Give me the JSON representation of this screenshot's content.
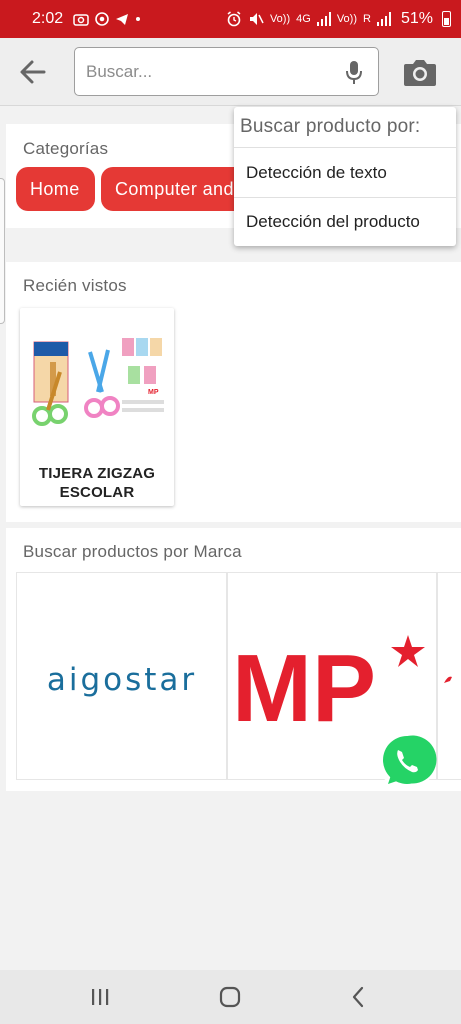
{
  "status_bar": {
    "time": "2:02",
    "net_labels": [
      "Vo))",
      "4G",
      "Vo))",
      "R"
    ],
    "battery": "51%"
  },
  "search": {
    "placeholder": "Buscar..."
  },
  "dropdown": {
    "header": "Buscar producto por:",
    "items": [
      {
        "label": "Detección de texto"
      },
      {
        "label": "Detección del producto"
      }
    ]
  },
  "categories": {
    "title": "Categorías",
    "chips": [
      {
        "label": "Home"
      },
      {
        "label": "Computer and"
      }
    ]
  },
  "recent": {
    "title": "Recién vistos",
    "products": [
      {
        "name": "TIJERA ZIGZAG ESCOLAR"
      }
    ]
  },
  "brands": {
    "title": "Buscar productos por Marca",
    "items": [
      {
        "name": "aigostar",
        "color": "#1a6e9c"
      },
      {
        "name": "MP",
        "color": "#e4202e"
      }
    ]
  },
  "colors": {
    "status_bar": "#c9191e",
    "chip": "#e53935",
    "whatsapp": "#25d366"
  },
  "icons": {
    "back": "arrow-left-icon",
    "mic": "microphone-icon",
    "camera": "camera-icon",
    "whatsapp": "whatsapp-icon",
    "nav_recents": "recents-icon",
    "nav_home": "home-icon",
    "nav_back": "back-chevron-icon"
  }
}
